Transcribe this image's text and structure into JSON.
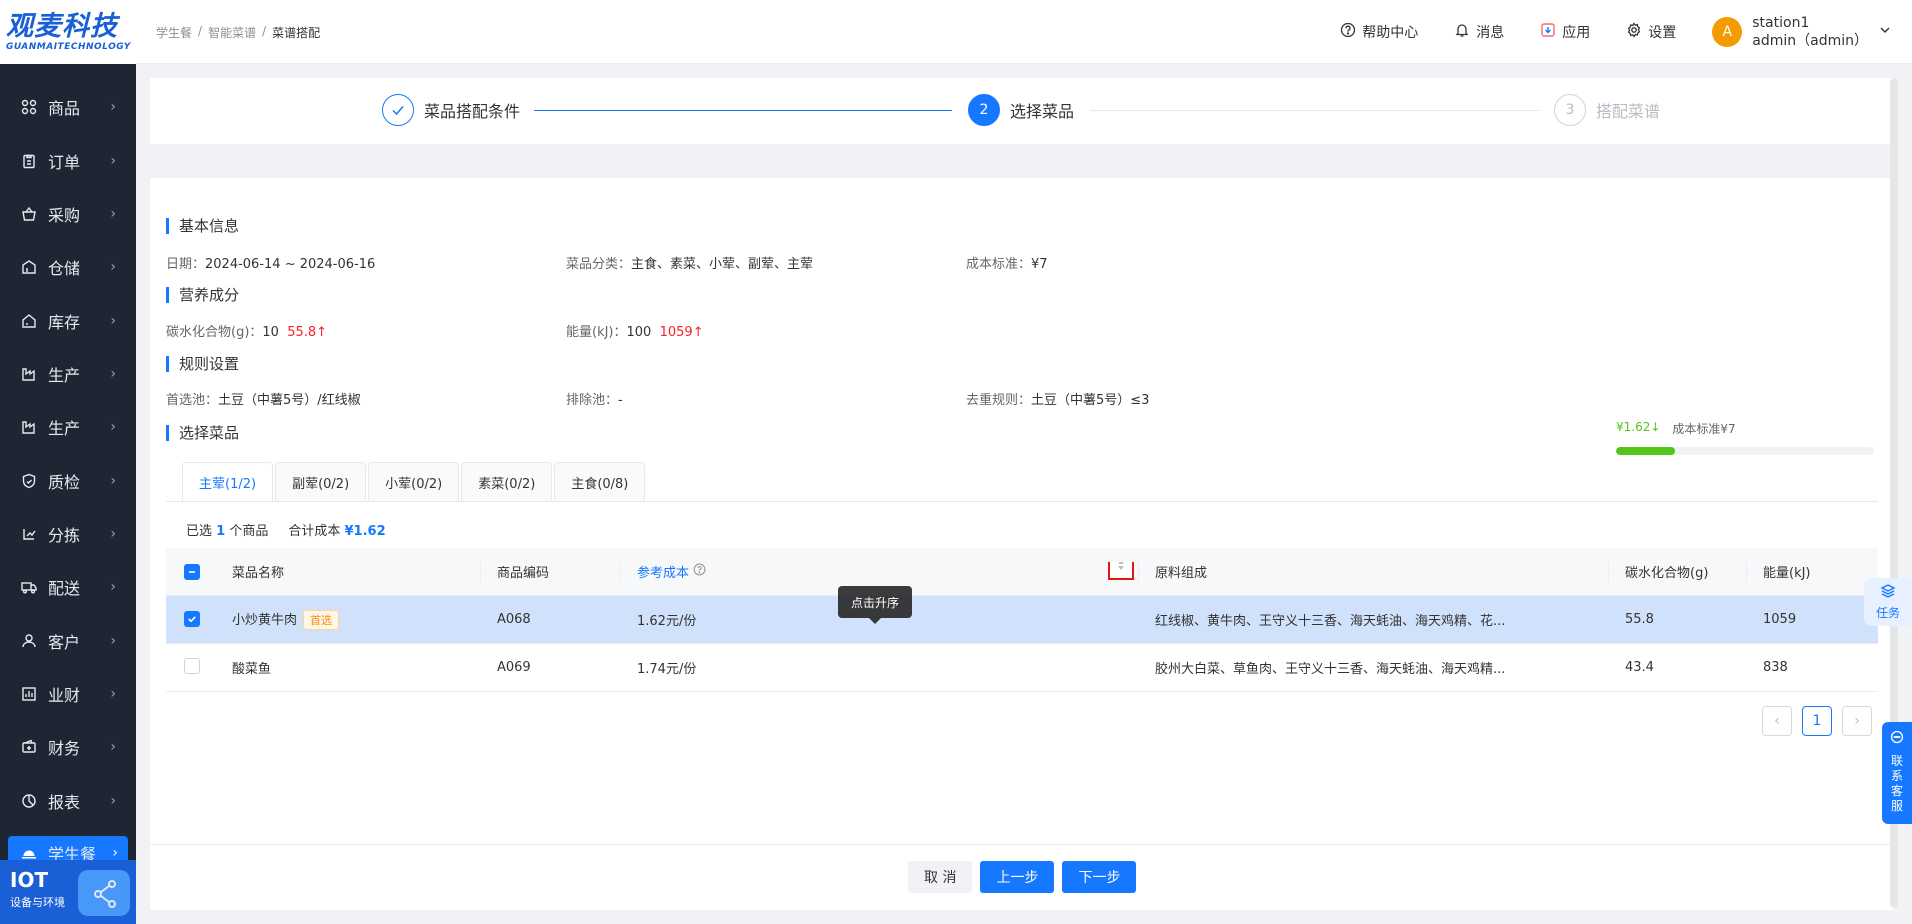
{
  "logo": {
    "main": "观麦科技",
    "sub": "GUANMAITECHNOLOGY"
  },
  "sidebar": {
    "items": [
      {
        "label": "商品",
        "icon": "grid-icon"
      },
      {
        "label": "订单",
        "icon": "clipboard-icon"
      },
      {
        "label": "采购",
        "icon": "basket-icon"
      },
      {
        "label": "仓储",
        "icon": "warehouse-icon"
      },
      {
        "label": "库存",
        "icon": "house-icon"
      },
      {
        "label": "生产",
        "icon": "factory-icon"
      },
      {
        "label": "生产",
        "icon": "factory-icon"
      },
      {
        "label": "质检",
        "icon": "shield-icon"
      },
      {
        "label": "分拣",
        "icon": "sort-icon"
      },
      {
        "label": "配送",
        "icon": "truck-icon"
      },
      {
        "label": "客户",
        "icon": "user-icon"
      },
      {
        "label": "业财",
        "icon": "bar-chart-icon"
      },
      {
        "label": "财务",
        "icon": "wallet-icon"
      },
      {
        "label": "报表",
        "icon": "pie-chart-icon"
      },
      {
        "label": "学生餐",
        "icon": "meal-icon"
      }
    ],
    "iot_title": "IOT",
    "iot_sub": "设备与环境"
  },
  "header": {
    "breadcrumb": [
      "学生餐",
      "智能菜谱",
      "菜谱搭配"
    ],
    "help": "帮助中心",
    "messages": "消息",
    "apps": "应用",
    "settings": "设置",
    "avatar_letter": "A",
    "station": "station1",
    "username": "admin（admin）"
  },
  "steps": [
    {
      "label": "菜品搭配条件",
      "status": "done"
    },
    {
      "label": "选择菜品",
      "number": "2",
      "status": "active"
    },
    {
      "label": "搭配菜谱",
      "number": "3",
      "status": "wait"
    }
  ],
  "basic": {
    "title": "基本信息",
    "date_label": "日期：",
    "date_value": "2024-06-14 ~ 2024-06-16",
    "category_label": "菜品分类：",
    "category_value": "主食、素菜、小荤、副荤、主荤",
    "cost_label": "成本标准：",
    "cost_value": "¥7"
  },
  "nutrition": {
    "title": "营养成分",
    "carb_label": "碳水化合物(g)：",
    "carb_value": "10",
    "carb_actual": "55.8↑",
    "energy_label": "能量(kJ)：",
    "energy_value": "100",
    "energy_actual": "1059↑"
  },
  "rules": {
    "title": "规则设置",
    "prefer_label": "首选池：",
    "prefer_value": "土豆（中薯5号）/红线椒",
    "exclude_label": "排除池：",
    "exclude_value": "-",
    "dedupe_label": "去重规则：",
    "dedupe_value": "土豆（中薯5号）≤3"
  },
  "select": {
    "title": "选择菜品",
    "cost_current": "¥1.62↓",
    "cost_standard": "成本标准¥7",
    "cost_progress": 0.23,
    "tabs": [
      "主荤(1/2)",
      "副荤(0/2)",
      "小荤(0/2)",
      "素菜(0/2)",
      "主食(0/8)"
    ],
    "summary_selected_pre": "已选",
    "summary_selected_count": "1",
    "summary_selected_post": "个商品",
    "summary_total_label": "合计成本",
    "summary_total_value": "¥1.62",
    "tooltip": "点击升序"
  },
  "table": {
    "headers": [
      "菜品名称",
      "商品编码",
      "参考成本",
      "原料组成",
      "碳水化合物(g)",
      "能量(kJ)"
    ],
    "rows": [
      {
        "name": "小炒黄牛肉",
        "badge": "首选",
        "code": "A068",
        "cost": "1.62元/份",
        "ingredients": "红线椒、黄牛肉、王守义十三香、海天蚝油、海天鸡精、花...",
        "carb": "55.8",
        "energy": "1059",
        "checked": true
      },
      {
        "name": "酸菜鱼",
        "badge": "",
        "code": "A069",
        "cost": "1.74元/份",
        "ingredients": "胶州大白菜、草鱼肉、王守义十三香、海天蚝油、海天鸡精...",
        "carb": "43.4",
        "energy": "838",
        "checked": false
      }
    ]
  },
  "pager": {
    "prev": "‹",
    "current": "1",
    "next": "›"
  },
  "footer": {
    "cancel": "取 消",
    "prev_step": "上一步",
    "next_step": "下一步"
  },
  "float": {
    "task": "任务",
    "service": [
      "联",
      "系",
      "客",
      "服"
    ]
  },
  "colors": {
    "primary": "#1677ff",
    "sidebar": "#1f2633",
    "success": "#52c41a",
    "danger": "#f5222d"
  }
}
